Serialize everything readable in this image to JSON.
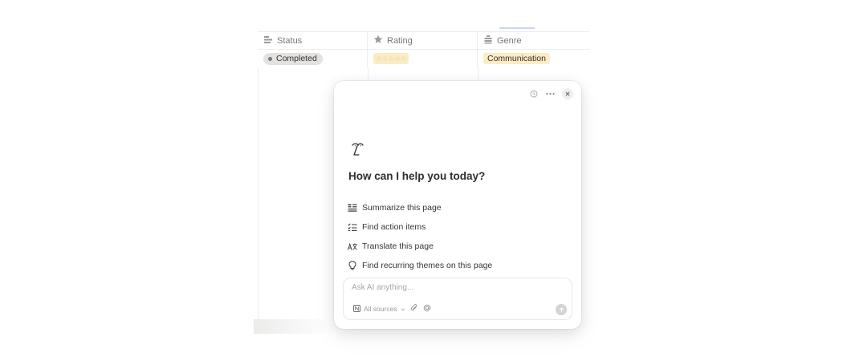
{
  "table": {
    "columns": [
      {
        "label": "Status",
        "icon": "status-icon"
      },
      {
        "label": "Rating",
        "icon": "star-icon"
      },
      {
        "label": "Genre",
        "icon": "list-icon"
      }
    ],
    "row": {
      "status": "Completed",
      "rating_stars": "☆☆☆☆☆",
      "genre": "Communication"
    }
  },
  "ai_panel": {
    "greeting": "How can I help you today?",
    "suggestions": [
      {
        "label": "Summarize this page",
        "icon": "summary-icon"
      },
      {
        "label": "Find action items",
        "icon": "checklist-icon"
      },
      {
        "label": "Translate this page",
        "icon": "translate-icon"
      },
      {
        "label": "Find recurring themes on this page",
        "icon": "lightbulb-icon"
      }
    ],
    "input_placeholder": "Ask AI anything...",
    "sources_label": "All sources"
  },
  "colors": {
    "status_pill_bg": "#e3e2e0",
    "genre_pill_bg": "#fbecc8",
    "text": "#37352f",
    "muted": "#787774"
  }
}
